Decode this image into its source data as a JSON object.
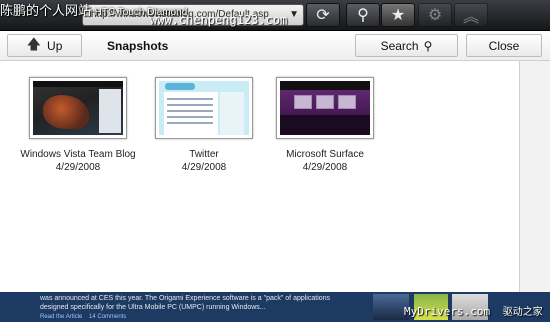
{
  "watermark": {
    "top_cn": "陈鹏的个人网站",
    "top_sub": "HTC Touch Diamond",
    "top_url": "www.chenpeng123.com",
    "bottom_site": "MyDrivers.com",
    "bottom_cn": "驱动之家"
  },
  "toolbar": {
    "address": "http://windowsvistablog.com/Default.asp",
    "address_dropdown_icon": "caret-down-icon",
    "refresh_icon": "refresh-icon",
    "search_icon": "magnifier-icon",
    "favorites_icon": "star-icon",
    "settings_icon": "gear-icon",
    "collapse_icon": "double-chevron-up-icon"
  },
  "panel": {
    "up_label": "Up",
    "title": "Snapshots",
    "search_label": "Search",
    "close_label": "Close",
    "snapshots": [
      {
        "title": "Windows Vista Team Blog",
        "date": "4/29/2008"
      },
      {
        "title": "Twitter",
        "date": "4/29/2008"
      },
      {
        "title": "Microsoft Surface",
        "date": "4/29/2008"
      }
    ]
  },
  "background_page": {
    "line1": "was announced at CES this year. The Origami Experience software is a \"pack\" of applications",
    "line2": "designed specifically for the Ultra Mobile PC (UMPC) running Windows...",
    "link_read": "Read the Article",
    "link_comments": "14 Comments"
  }
}
